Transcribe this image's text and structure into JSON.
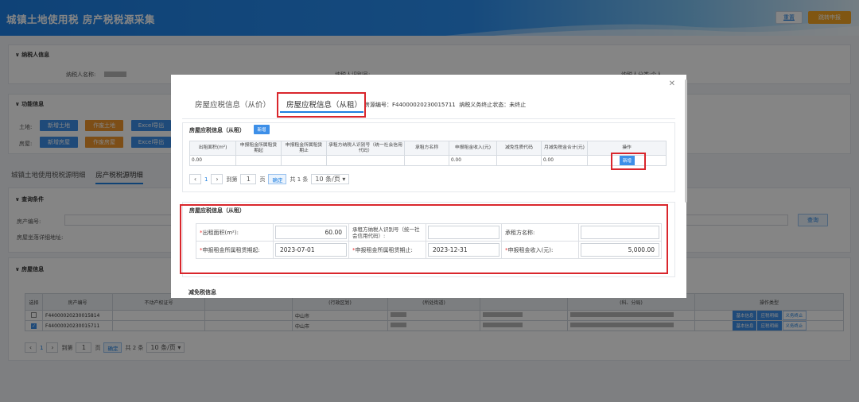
{
  "header": {
    "title": "城镇土地使用税 房产税税源采集",
    "reset_label": "重置",
    "submit_label": "跳转申报"
  },
  "taxpayer": {
    "section_title": "纳税人信息",
    "name_label": "纳税人名称:",
    "id_label": "纳税人识别号:",
    "type_label": "纳税人分类:",
    "type_value": "个人"
  },
  "function": {
    "section_title": "功能信息",
    "land_label": "土地:",
    "house_label": "房屋:",
    "buttons_land": [
      "新增土地",
      "作废土地",
      "Excel导出"
    ],
    "buttons_house": [
      "新增房屋",
      "作废房屋",
      "Excel导出"
    ]
  },
  "tabs": [
    "城镇土地使用税税源明细",
    "房产税税源明细"
  ],
  "query": {
    "section_title": "查询条件",
    "house_no_label": "房产编号:",
    "address_label": "房屋坐落详细地址:",
    "search_label": "查询"
  },
  "houses": {
    "section_title": "房屋信息",
    "headers": [
      "选择",
      "房产编号",
      "不动产权证号",
      "",
      "(行政区划)",
      "(所处街道)",
      "",
      "(科、分局)",
      "操作类型"
    ],
    "rows": [
      {
        "checked": false,
        "house_no": "F44000020230015814",
        "region": "中山市"
      },
      {
        "checked": true,
        "house_no": "F44000020230015711",
        "region": "中山市"
      }
    ],
    "ops": [
      "基本信息",
      "应税明细",
      "义务终止"
    ],
    "pager": {
      "current": "1",
      "goto_label": "到第",
      "page_value": "1",
      "page_suffix": "页",
      "ok_label": "确定",
      "total": "共 2 条",
      "size": "10 条/页"
    }
  },
  "modal": {
    "tab1": "房屋应税信息（从价）",
    "tab2": "房屋应税信息（从租）",
    "source_no_label": "房源编号：",
    "source_no": "F44000020230015711",
    "status_label": "纳税义务终止状态：",
    "status_value": "未终止",
    "rent_section_title": "房屋应税信息（从租）",
    "add_label": "新增",
    "table_headers": [
      "出租面积(m²)",
      "申报租金所属租赁期起",
      "申报租金所属租赁期止",
      "承租方纳税人识别号（统一社会信用代码）",
      "承租方名称",
      "申报租金收入(元)",
      "减免性质代码",
      "月减免税金合计(元)",
      "操作"
    ],
    "table_row": {
      "area": "0.00",
      "income": "0.00",
      "relief": "0.00",
      "op": "新增"
    },
    "pager": {
      "current": "1",
      "goto_label": "到第",
      "page_value": "1",
      "page_suffix": "页",
      "ok_label": "确定",
      "total": "共 1 条",
      "size": "10 条/页"
    },
    "form_title": "房屋应税信息（从租）",
    "form": {
      "area_label": "出租面积(m²):",
      "area_value": "60.00",
      "tenant_id_label": "承租方纳税人识别号（统一社会信用代码）:",
      "tenant_name_label": "承租方名称:",
      "start_label": "申报租金所属租赁期起:",
      "start_value": "2023-07-01",
      "end_label": "申报租金所属租赁期止:",
      "end_value": "2023-12-31",
      "income_label": "申报租金收入(元):",
      "income_value": "5,000.00"
    },
    "relief_title": "减免税信息"
  }
}
